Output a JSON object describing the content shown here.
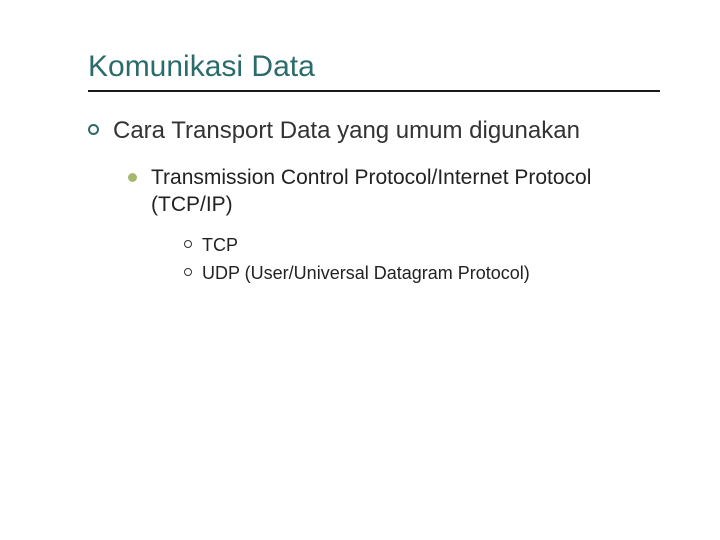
{
  "title": "Komunikasi Data",
  "bullets": {
    "l1": "Cara Transport Data yang umum digunakan",
    "l2": "Transmission Control Protocol/Internet Protocol (TCP/IP)",
    "l3a": "TCP",
    "l3b": "UDP (User/Universal Datagram Protocol)"
  },
  "colors": {
    "title": "#2b6b6b",
    "rule": "#1a1a1a",
    "l2_bullet": "#a6b86f"
  }
}
